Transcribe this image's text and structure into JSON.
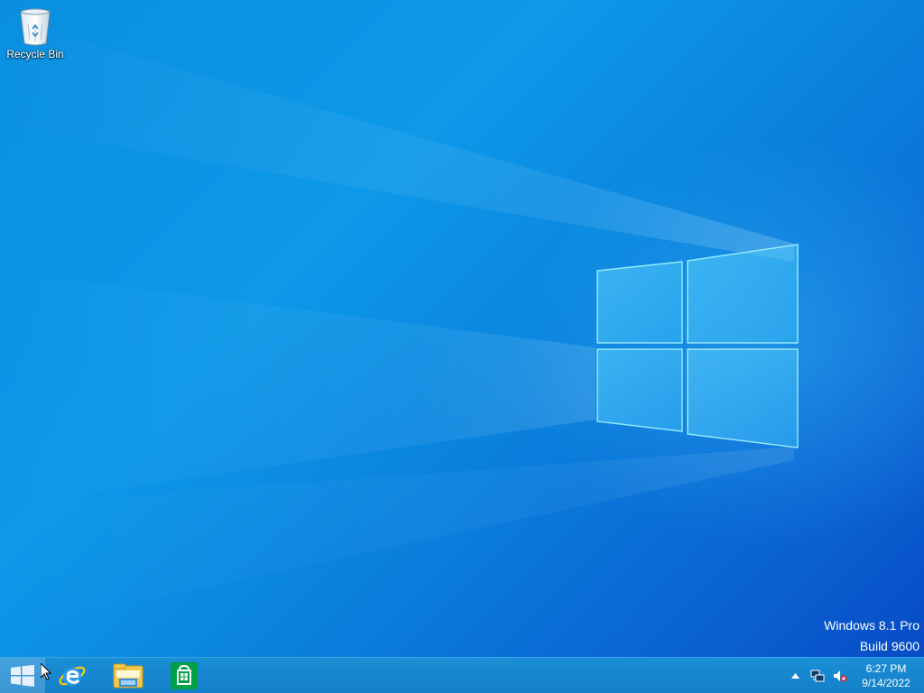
{
  "desktop": {
    "icons": [
      {
        "label": "Recycle Bin",
        "icon": "recycle-bin-icon"
      }
    ],
    "watermark": {
      "line1": "Windows 8.1 Pro",
      "line2": "Build 9600"
    }
  },
  "taskbar": {
    "start": {
      "icon": "windows-logo-icon"
    },
    "pinned": [
      {
        "icon": "internet-explorer-icon"
      },
      {
        "icon": "file-explorer-icon"
      },
      {
        "icon": "store-icon"
      }
    ],
    "tray": {
      "icons": [
        "show-hidden-icons-icon",
        "network-icon",
        "volume-muted-icon"
      ]
    },
    "clock": {
      "time": "6:27 PM",
      "date": "9/14/2022"
    }
  },
  "colors": {
    "wallpaper_accent": "#0a8fe0",
    "taskbar": "#1a8fd6",
    "text": "#ffffff"
  }
}
